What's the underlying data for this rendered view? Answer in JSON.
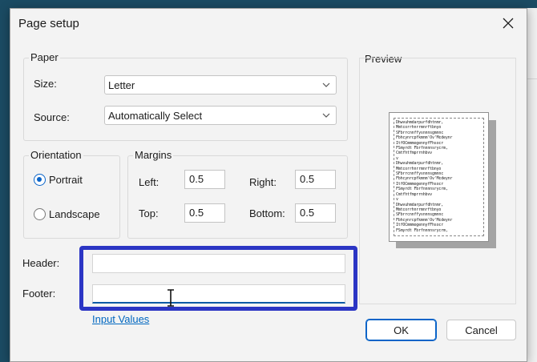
{
  "dialog": {
    "title": "Page setup",
    "paper": {
      "group_label": "Paper",
      "size_label": "Size:",
      "size_value": "Letter",
      "source_label": "Source:",
      "source_value": "Automatically Select"
    },
    "orientation": {
      "group_label": "Orientation",
      "portrait": "Portrait",
      "landscape": "Landscape",
      "selected": "portrait"
    },
    "margins": {
      "group_label": "Margins",
      "left_label": "Left:",
      "left_value": "0.5",
      "right_label": "Right:",
      "right_value": "0.5",
      "top_label": "Top:",
      "top_value": "0.5",
      "bottom_label": "Bottom:",
      "bottom_value": "0.5"
    },
    "header_label": "Header:",
    "header_value": "",
    "footer_label": "Footer:",
    "footer_value": "",
    "input_values_link": "Input Values",
    "preview": {
      "group_label": "Preview"
    },
    "ok_label": "OK",
    "cancel_label": "Cancel"
  },
  "colors": {
    "accent": "#0a64c8",
    "highlight_box": "#2b35c4",
    "link": "#0067c0",
    "backdrop": "#1b4b63"
  },
  "icons": {
    "close": "close-icon",
    "dropdown": "chevron-down-icon",
    "cursor": "text-cursor-icon"
  }
}
